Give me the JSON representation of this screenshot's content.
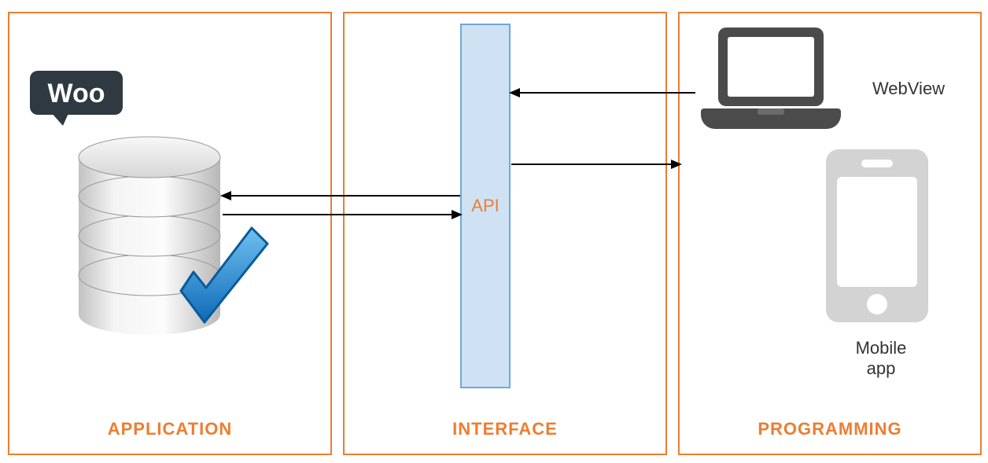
{
  "panels": {
    "application": {
      "label": "APPLICATION"
    },
    "interface": {
      "label": "INTERFACE"
    },
    "programming": {
      "label": "PROGRAMMING"
    }
  },
  "api_label": "API",
  "woo_label": "Woo",
  "clients": {
    "webview": "WebView",
    "mobile": "Mobile app"
  },
  "colors": {
    "orange": "#ED7D31",
    "api_fill": "#CFE2F3",
    "api_border": "#6FA8DC",
    "dark": "#4B4B4B",
    "light_grey": "#D3D3D3",
    "check_blue": "#1E90E6"
  }
}
